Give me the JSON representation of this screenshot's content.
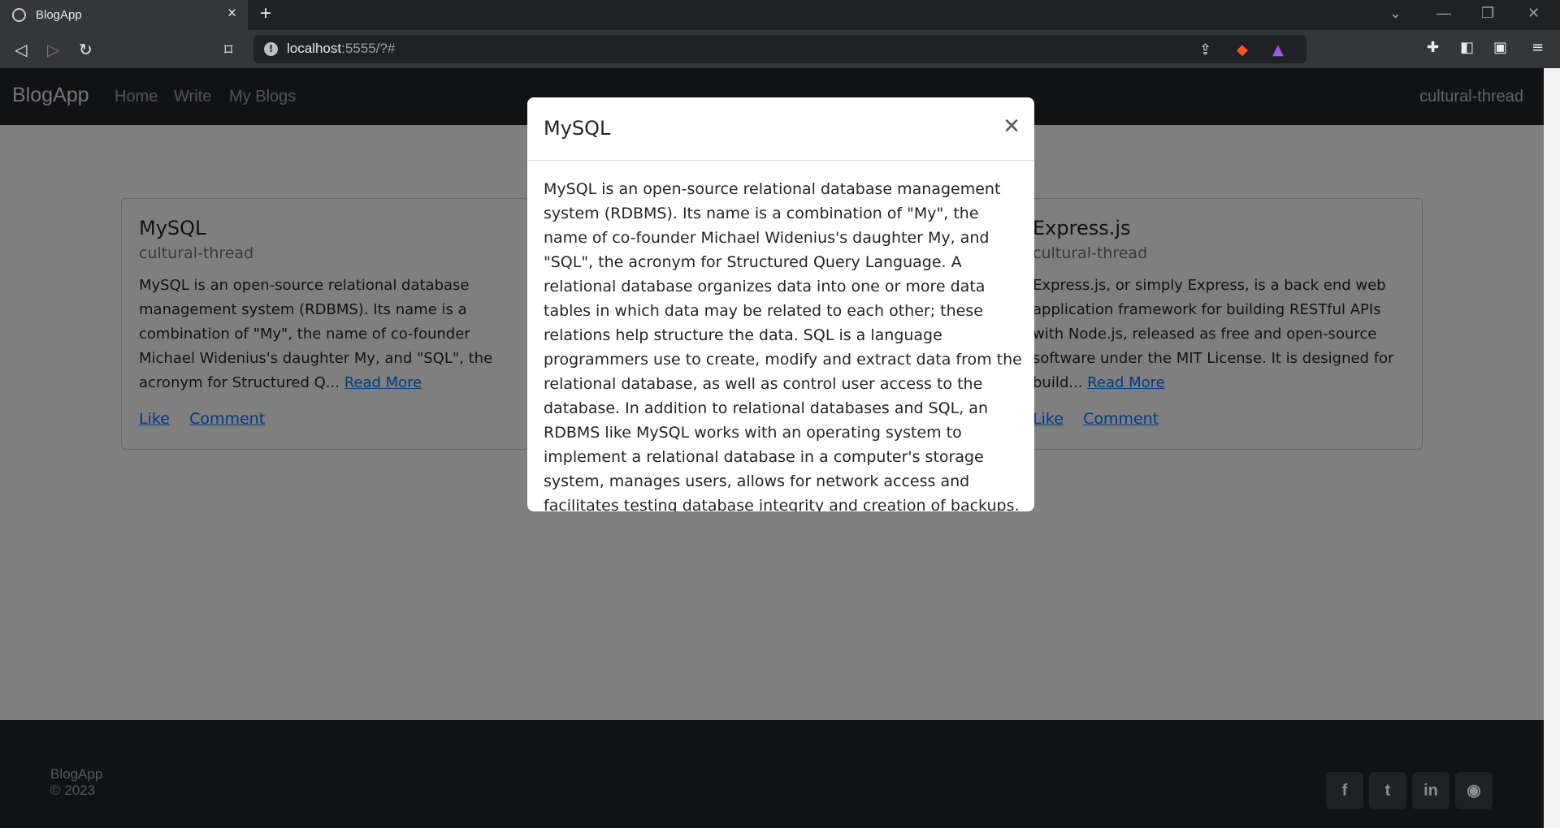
{
  "browser": {
    "tab_title": "BlogApp",
    "tab_close": "×",
    "new_tab": "+",
    "url_host": "localhost",
    "url_rest": ":5555/?#"
  },
  "nav": {
    "brand": "BlogApp",
    "links": [
      "Home",
      "Write",
      "My Blogs"
    ],
    "user": "cultural-thread"
  },
  "cards": [
    {
      "title": "MySQL",
      "author": "cultural-thread",
      "excerpt": "MySQL is an open-source relational database management system (RDBMS). Its name is a combination of \"My\", the name of co-founder Michael Widenius's daughter My, and \"SQL\", the acronym for Structured Q...",
      "read_more": "Read More",
      "like": "Like",
      "comment": "Comment"
    },
    {
      "title": "Express.js",
      "author": "cultural-thread",
      "excerpt": "Express.js, or simply Express, is a back end web application framework for building RESTful APIs with Node.js, released as free and open-source software under the MIT License. It is designed for build...",
      "read_more": "Read More",
      "like": "Like",
      "comment": "Comment"
    }
  ],
  "modal": {
    "title": "MySQL",
    "close": "×",
    "body": "MySQL is an open-source relational database management system (RDBMS). Its name is a combination of \"My\", the name of co-founder Michael Widenius's daughter My, and \"SQL\", the acronym for Structured Query Language. A relational database organizes data into one or more data tables in which data may be related to each other; these relations help structure the data. SQL is a language programmers use to create, modify and extract data from the relational database, as well as control user access to the database. In addition to relational databases and SQL, an RDBMS like MySQL works with an operating system to implement a relational database in a computer's storage system, manages users, allows for network access and facilitates testing database integrity and creation of backups."
  },
  "footer": {
    "copyright": "BlogApp © 2023",
    "social_icons": [
      "facebook-icon",
      "twitter-icon",
      "linkedin-icon",
      "github-icon"
    ]
  }
}
